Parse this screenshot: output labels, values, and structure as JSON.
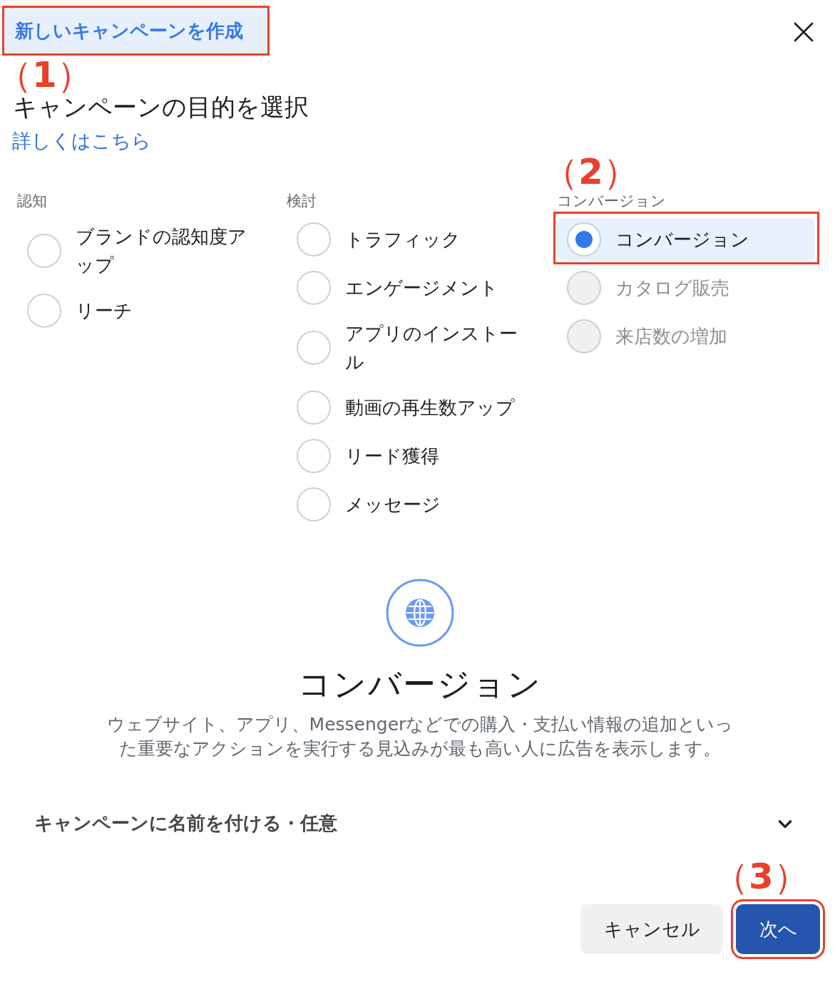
{
  "tab": {
    "label": "新しいキャンペーンを作成",
    "selected": true,
    "highlighted": true,
    "callout": "（**1**）"
  },
  "title": "キャンペーンの目的を選択",
  "link": "詳しくはこちら",
  "groups": [
    {
      "label": "認知",
      "options": [
        {
          "label": "ブランドの認知度アップ",
          "selected": false,
          "disabled": false
        },
        {
          "label": "リーチ",
          "selected": false,
          "disabled": false
        }
      ]
    },
    {
      "label": "検討",
      "options": [
        {
          "label": "トラフィック",
          "selected": false,
          "disabled": false
        },
        {
          "label": "エンゲージメント",
          "selected": false,
          "disabled": false
        },
        {
          "label": "アプリのインストール",
          "selected": false,
          "disabled": false
        },
        {
          "label": "動画の再生数アップ",
          "selected": false,
          "disabled": false
        },
        {
          "label": "リード獲得",
          "selected": false,
          "disabled": false
        },
        {
          "label": "メッセージ",
          "selected": false,
          "disabled": false
        }
      ]
    },
    {
      "label": "コンバージョン",
      "callout": "（**2**）",
      "options": [
        {
          "label": "コンバージョン",
          "selected": true,
          "disabled": false,
          "highlighted": true
        },
        {
          "label": "カタログ販売",
          "selected": false,
          "disabled": true
        },
        {
          "label": "来店数の増加",
          "selected": false,
          "disabled": true
        }
      ]
    }
  ],
  "detail": {
    "heading": "コンバージョン",
    "description": "ウェブサイト、アプリ、Messengerなどでの購入・支払い情報の追加といった重要なアクションを実行する見込みが最も高い人に広告を表示します。"
  },
  "name_section": {
    "label": "キャンペーンに名前を付ける・任意",
    "expanded": false
  },
  "buttons": [
    {
      "label": "キャンセル",
      "kind": "secondary",
      "highlighted": false
    },
    {
      "label": "次へ",
      "kind": "primary",
      "highlighted": true,
      "callout": "（**3**）"
    }
  ]
}
